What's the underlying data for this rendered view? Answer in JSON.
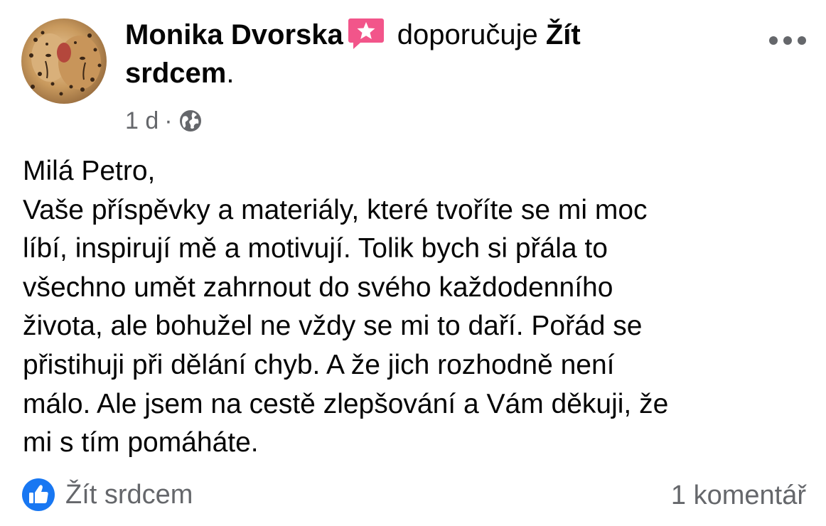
{
  "post": {
    "author": "Monika Dvorska",
    "badge_icon": "recommend-star-badge-icon",
    "verb": "doporučuje",
    "page_name": "Žít srdcem",
    "period": ".",
    "time": "1 d",
    "separator": "·",
    "privacy_icon": "globe-icon",
    "more_icon": "more-options-icon",
    "body_lines": [
      "Milá Petro,",
      "Vaše příspěvky a materiály, které tvoříte se mi moc",
      "líbí, inspirují mě a motivují. Tolik bych si přála to",
      "všechno umět zahrnout do svého každodenního",
      "života, ale bohužel ne vždy se mi to daří. Pořád se",
      "přistihuji při dělání chyb. A že jich rozhodně není",
      "málo. Ale jsem na cestě zlepšování a Vám děkuji, že",
      "mi s tím pomáháte."
    ]
  },
  "footer": {
    "reaction_icon": "like-icon",
    "reaction_label": "Žít srdcem",
    "comments_label": "1 komentář"
  },
  "colors": {
    "text_primary": "#050505",
    "text_secondary": "#65676b",
    "like_blue": "#1877f2",
    "badge_pink": "#f2558a"
  }
}
